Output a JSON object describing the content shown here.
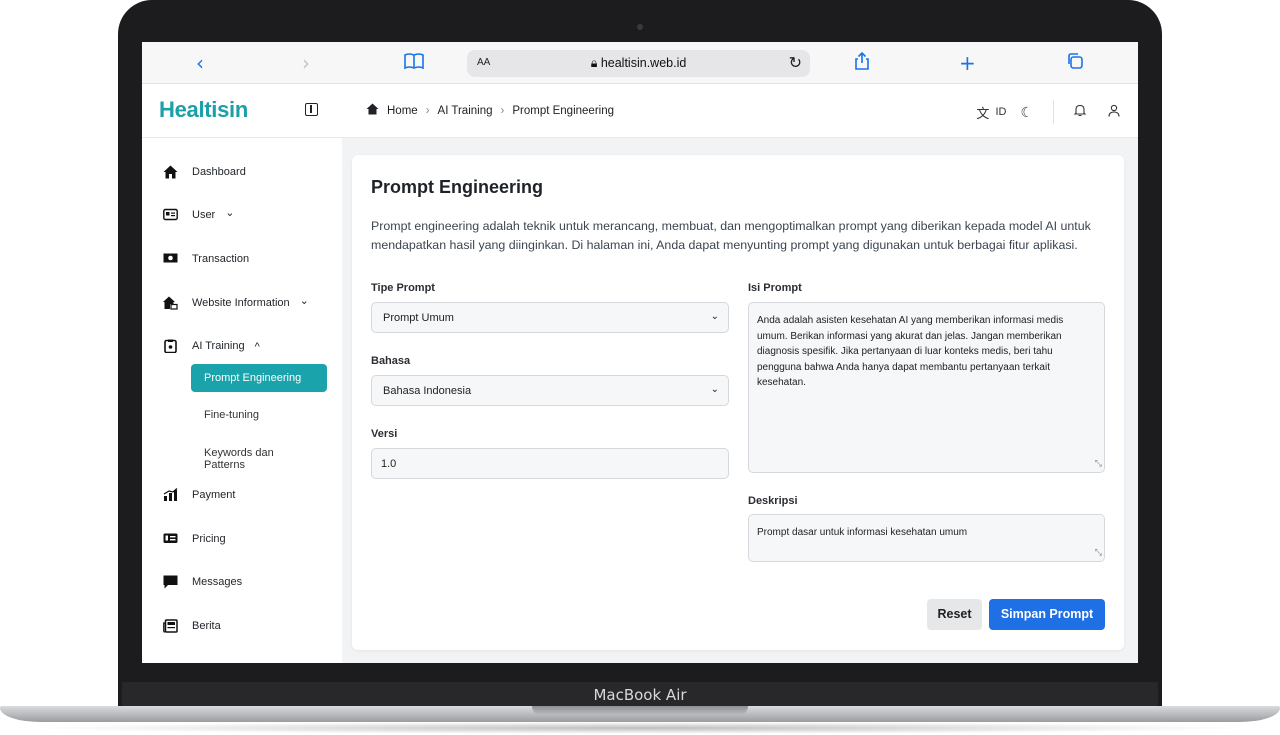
{
  "device": {
    "label": "MacBook Air"
  },
  "browser": {
    "text_size_label": "AA",
    "url": "healtisin.web.id",
    "back_icon": "chevron-left-icon",
    "forward_icon": "chevron-right-icon",
    "accent_color": "#1a73e8"
  },
  "header": {
    "logo": "Healtisin",
    "breadcrumb": [
      "Home",
      "AI Training",
      "Prompt Engineering"
    ],
    "language": "ID"
  },
  "sidebar": {
    "items": [
      {
        "label": "Dashboard",
        "icon": "home-icon"
      },
      {
        "label": "User",
        "icon": "id-card-icon",
        "chevron": "⌄"
      },
      {
        "label": "Transaction",
        "icon": "money-icon"
      },
      {
        "label": "Website Information",
        "icon": "house-cog-icon",
        "chevron": "⌄"
      },
      {
        "label": "AI Training",
        "icon": "clipboard-icon",
        "chevron": "^"
      },
      {
        "label": "Payment",
        "icon": "chart-icon"
      },
      {
        "label": "Pricing",
        "icon": "dollar-card-icon"
      },
      {
        "label": "Messages",
        "icon": "message-icon"
      },
      {
        "label": "Berita",
        "icon": "newspaper-icon"
      }
    ],
    "subitems": [
      {
        "label": "Prompt Engineering",
        "active": true
      },
      {
        "label": "Fine-tuning",
        "active": false
      },
      {
        "label": "Keywords dan Patterns",
        "active": false
      }
    ],
    "active_color": "#1aa3aa"
  },
  "main": {
    "title": "Prompt Engineering",
    "description": "Prompt engineering adalah teknik untuk merancang, membuat, dan mengoptimalkan prompt yang diberikan kepada model AI untuk mendapatkan hasil yang diinginkan. Di halaman ini, Anda dapat menyunting prompt yang digunakan untuk berbagai fitur aplikasi.",
    "fields": {
      "tipe_prompt": {
        "label": "Tipe Prompt",
        "value": "Prompt Umum"
      },
      "bahasa": {
        "label": "Bahasa",
        "value": "Bahasa Indonesia"
      },
      "versi": {
        "label": "Versi",
        "value": "1.0"
      },
      "isi_prompt": {
        "label": "Isi Prompt",
        "value": "Anda adalah asisten kesehatan AI yang memberikan informasi medis umum. Berikan informasi yang akurat dan jelas. Jangan memberikan diagnosis spesifik. Jika pertanyaan di luar konteks medis, beri tahu pengguna bahwa Anda hanya dapat membantu pertanyaan terkait kesehatan."
      },
      "deskripsi": {
        "label": "Deskripsi",
        "value": "Prompt dasar untuk informasi kesehatan umum"
      }
    },
    "buttons": {
      "reset": "Reset",
      "save": "Simpan Prompt"
    },
    "primary_color": "#1f6fe5"
  }
}
